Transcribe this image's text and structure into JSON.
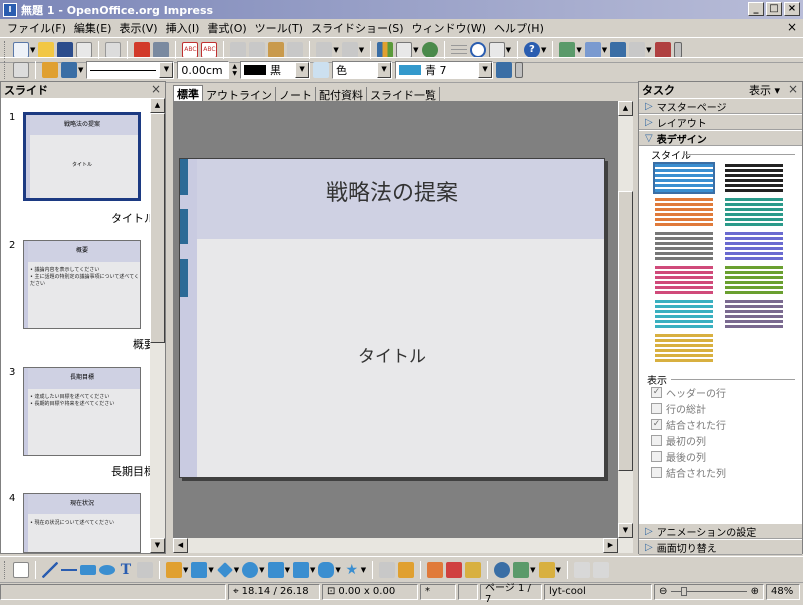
{
  "window": {
    "title": "無題 1 - OpenOffice.org Impress",
    "icon": "impress-app-icon"
  },
  "menu": [
    "ファイル(F)",
    "編集(E)",
    "表示(V)",
    "挿入(I)",
    "書式(O)",
    "ツール(T)",
    "スライドショー(S)",
    "ウィンドウ(W)",
    "ヘルプ(H)"
  ],
  "line_toolbar": {
    "line_width": "0.00cm",
    "line_color": "黒",
    "fill_type": "色",
    "fill_color": "青 7",
    "line_color_hex": "#000000",
    "fill_color_hex": "#3399cc"
  },
  "slides_pane": {
    "title": "スライド",
    "slides": [
      {
        "num": "1",
        "title": "戦略法の提案",
        "subtitle": "タイトル",
        "label": "タイトル",
        "bullets": []
      },
      {
        "num": "2",
        "title": "概要",
        "label": "概要",
        "bullets": [
          "• 議論内容を表示してください",
          "• 主に話題の特別定の議論事項について述べてください"
        ]
      },
      {
        "num": "3",
        "title": "長期目標",
        "label": "長期目標",
        "bullets": [
          "• 達成したい目標を述べてください",
          "• 長期的目標や将来を述べてください"
        ]
      },
      {
        "num": "4",
        "title": "現在状況",
        "label": "",
        "bullets": [
          "• 現在の状況について述べてください"
        ]
      }
    ]
  },
  "view_tabs": [
    "標準",
    "アウトライン",
    "ノート",
    "配付資料",
    "スライド一覧"
  ],
  "slide": {
    "title": "戦略法の提案",
    "subtitle": "タイトル"
  },
  "task_pane": {
    "title": "タスク",
    "view_menu": "表示",
    "sections_top": [
      "マスターページ",
      "レイアウト",
      "表デザイン"
    ],
    "styles_label": "スタイル",
    "show_label": "表示",
    "options": [
      {
        "label": "ヘッダーの行",
        "checked": true
      },
      {
        "label": "行の総計",
        "checked": false
      },
      {
        "label": "結合された行",
        "checked": true
      },
      {
        "label": "最初の列",
        "checked": false
      },
      {
        "label": "最後の列",
        "checked": false
      },
      {
        "label": "結合された列",
        "checked": false
      }
    ],
    "sections_bottom": [
      "アニメーションの設定",
      "画面切り替え"
    ]
  },
  "status": {
    "position": "18.14 / 26.18",
    "size": "0.00 x 0.00",
    "modified": "*",
    "page": "ページ 1 / 7",
    "layout": "lyt-cool",
    "zoom": "48%"
  }
}
